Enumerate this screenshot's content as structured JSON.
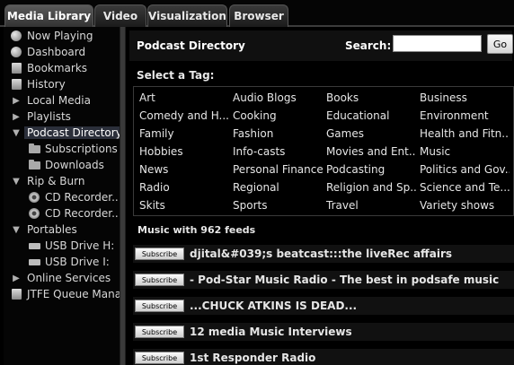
{
  "tabs": [
    {
      "label": "Media Library",
      "active": true
    },
    {
      "label": "Video",
      "active": false
    },
    {
      "label": "Visualization",
      "active": false
    },
    {
      "label": "Browser",
      "active": false
    }
  ],
  "sidebar": {
    "items": [
      {
        "label": "Now Playing",
        "icon": "play-circle-icon"
      },
      {
        "label": "Dashboard",
        "icon": "gauge-icon"
      },
      {
        "label": "Bookmarks",
        "icon": "bookmark-icon"
      },
      {
        "label": "History",
        "icon": "history-icon"
      },
      {
        "label": "Local Media",
        "icon": "expand-arrow-icon"
      },
      {
        "label": "Playlists",
        "icon": "expand-arrow-icon"
      },
      {
        "label": "Podcast Directory",
        "icon": "collapse-arrow-icon",
        "selected": true
      },
      {
        "label": "Subscriptions",
        "icon": "folder-icon"
      },
      {
        "label": "Downloads",
        "icon": "folder-icon"
      },
      {
        "label": "Rip & Burn",
        "icon": "collapse-arrow-icon"
      },
      {
        "label": "CD Recorder...",
        "icon": "cd-icon"
      },
      {
        "label": "CD Recorder...",
        "icon": "cd-icon"
      },
      {
        "label": "Portables",
        "icon": "collapse-arrow-icon"
      },
      {
        "label": "USB Drive H:",
        "icon": "usb-drive-icon"
      },
      {
        "label": "USB Drive I:",
        "icon": "usb-drive-icon"
      },
      {
        "label": "Online Services",
        "icon": "expand-arrow-icon"
      },
      {
        "label": "JTFE Queue Mana",
        "icon": "document-icon"
      }
    ]
  },
  "main": {
    "title": "Podcast Directory",
    "search_label": "Search:",
    "search_value": "",
    "go_label": "Go",
    "tag_heading": "Select a Tag:",
    "tags": [
      [
        "Art",
        "Audio Blogs",
        "Books",
        "Business"
      ],
      [
        "Comedy and H...",
        "Cooking",
        "Educational",
        "Environment"
      ],
      [
        "Family",
        "Fashion",
        "Games",
        "Health and Fitn..."
      ],
      [
        "Hobbies",
        "Info-casts",
        "Movies and Ent...",
        "Music"
      ],
      [
        "News",
        "Personal Finance",
        "Podcasting",
        "Politics and Gov..."
      ],
      [
        "Radio",
        "Regional",
        "Religion and Sp...",
        "Science and Te..."
      ],
      [
        "Skits",
        "Sports",
        "Travel",
        "Variety shows"
      ]
    ],
    "feeds_heading": "Music with 962 feeds",
    "subscribe_label": "Subscribe",
    "feeds": [
      "djital&#039;s beatcast:::the liveRec affairs",
      "- Pod-Star Music Radio - The best in podsafe music",
      "...CHUCK ATKINS IS DEAD...",
      "12 media Music Interviews",
      "1st Responder Radio"
    ]
  }
}
